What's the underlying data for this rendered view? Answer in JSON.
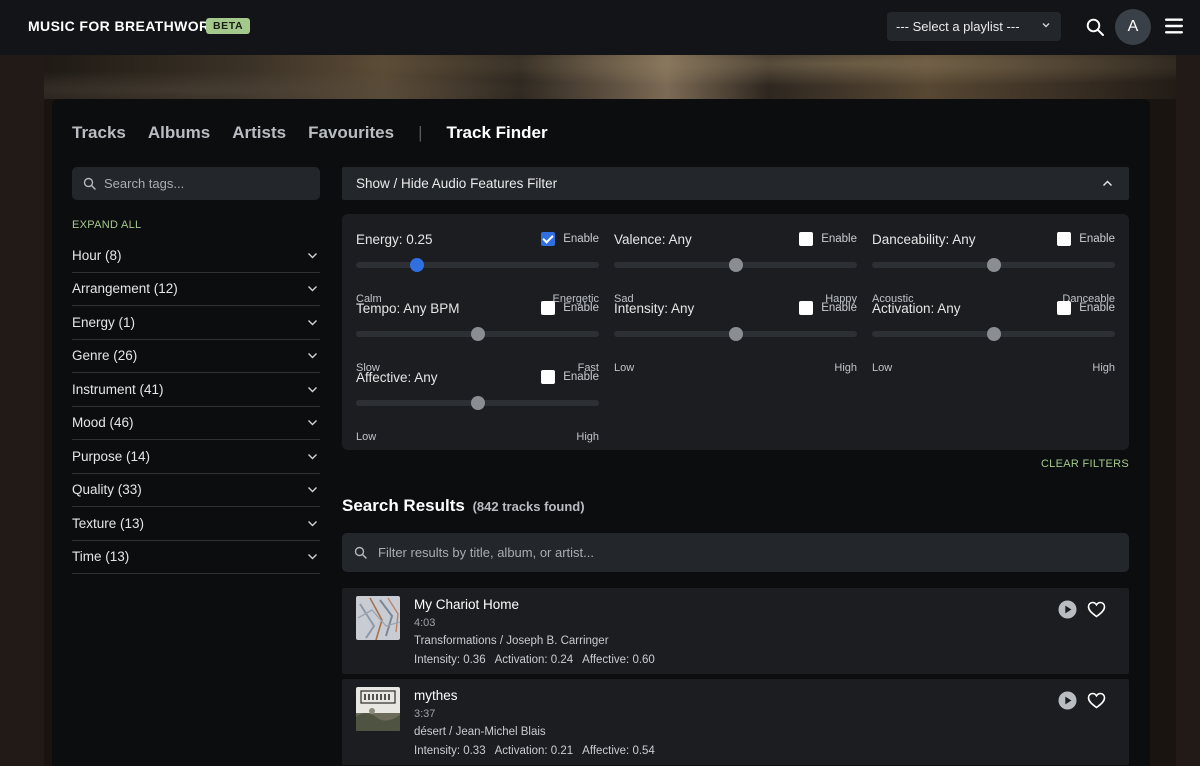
{
  "header": {
    "brand": "MUSIC FOR BREATHWORK",
    "badge": "BETA",
    "playlist_select": "--- Select a playlist ---",
    "avatar_initial": "A"
  },
  "tabs": [
    {
      "label": "Tracks",
      "active": false
    },
    {
      "label": "Albums",
      "active": false
    },
    {
      "label": "Artists",
      "active": false
    },
    {
      "label": "Favourites",
      "active": false
    },
    {
      "label": "Track Finder",
      "active": true
    }
  ],
  "tab_separator": "|",
  "sidebar": {
    "search_placeholder": "Search tags...",
    "expand_all": "EXPAND ALL",
    "tags": [
      "Hour (8)",
      "Arrangement (12)",
      "Energy (1)",
      "Genre (26)",
      "Instrument (41)",
      "Mood (46)",
      "Purpose (14)",
      "Quality (33)",
      "Texture (13)",
      "Time (13)"
    ]
  },
  "audio_features": {
    "toggle_label": "Show / Hide Audio Features Filter",
    "enable_label": "Enable",
    "clear_filters": "CLEAR FILTERS",
    "features": [
      {
        "label": "Energy: 0.25",
        "enabled": true,
        "value": 0.25,
        "low": "Calm",
        "high": "Energetic"
      },
      {
        "label": "Valence: Any",
        "enabled": false,
        "value": 0.5,
        "low": "Sad",
        "high": "Happy"
      },
      {
        "label": "Danceability: Any",
        "enabled": false,
        "value": 0.5,
        "low": "Acoustic",
        "high": "Danceable"
      },
      {
        "label": "Tempo: Any BPM",
        "enabled": false,
        "value": 0.5,
        "low": "Slow",
        "high": "Fast"
      },
      {
        "label": "Intensity: Any",
        "enabled": false,
        "value": 0.5,
        "low": "Low",
        "high": "High"
      },
      {
        "label": "Activation: Any",
        "enabled": false,
        "value": 0.5,
        "low": "Low",
        "high": "High"
      },
      {
        "label": "Affective: Any",
        "enabled": false,
        "value": 0.5,
        "low": "Low",
        "high": "High"
      }
    ]
  },
  "results": {
    "heading": "Search Results",
    "count": "(842 tracks found)",
    "filter_placeholder": "Filter results by title, album, or artist...",
    "tracks": [
      {
        "title": "My Chariot Home",
        "duration": "4:03",
        "album": "Transformations",
        "artist": "Joseph B. Carringer",
        "intensity": "Intensity: 0.36",
        "activation": "Activation: 0.24",
        "affective": "Affective: 0.60"
      },
      {
        "title": "mythes",
        "duration": "3:37",
        "album": "désert",
        "artist": "Jean-Michel Blais",
        "intensity": "Intensity: 0.33",
        "activation": "Activation: 0.21",
        "affective": "Affective: 0.54"
      }
    ]
  },
  "colors": {
    "accent": "#2f6fe0",
    "green": "#a5c98c",
    "panel": "#0c0d0f",
    "card": "#1b1d21"
  }
}
